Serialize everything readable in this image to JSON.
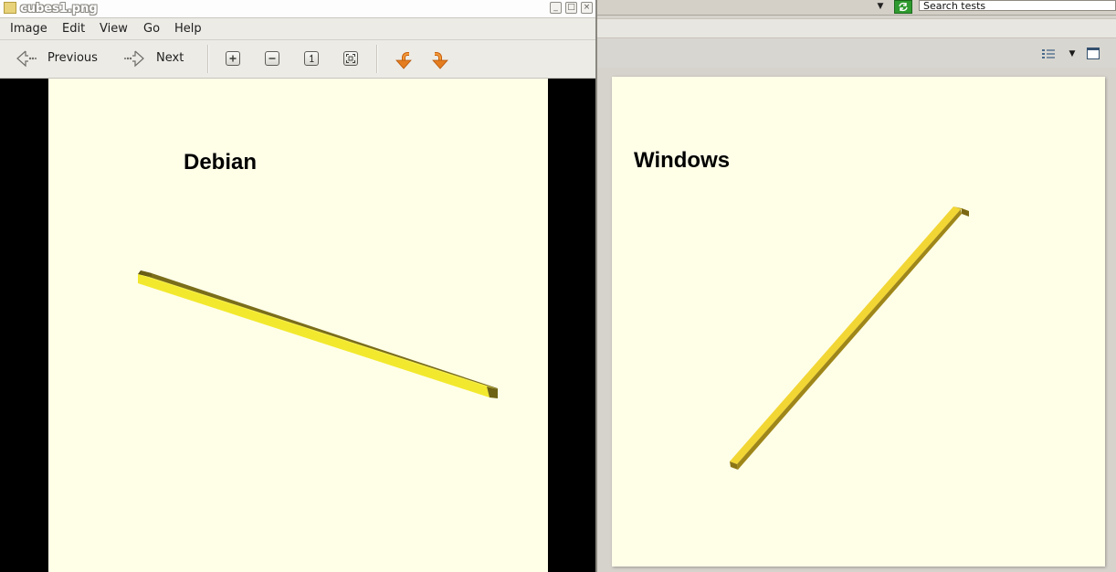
{
  "window": {
    "title": "cubes1.png",
    "minimize_glyph": "_",
    "maximize_glyph": "□",
    "close_glyph": "×"
  },
  "menubar": {
    "items": [
      "Image",
      "Edit",
      "View",
      "Go",
      "Help"
    ]
  },
  "toolbar": {
    "previous_label": "Previous",
    "next_label": "Next",
    "icons": [
      "back-arrow-icon",
      "forward-arrow-icon",
      "zoom-in-icon",
      "zoom-out-icon",
      "zoom-normal-icon",
      "zoom-fit-icon",
      "rotate-left-icon",
      "rotate-right-icon"
    ]
  },
  "left_image": {
    "label": "Debian",
    "bar_color": "#f2e92e",
    "shadow_color": "#7a6d1a",
    "background": "#ffffe8"
  },
  "right_window": {
    "search_value": "Search tests",
    "image": {
      "label": "Windows",
      "bar_color": "#f0d22e",
      "shadow_color": "#8b7515",
      "background": "#ffffe8"
    }
  }
}
